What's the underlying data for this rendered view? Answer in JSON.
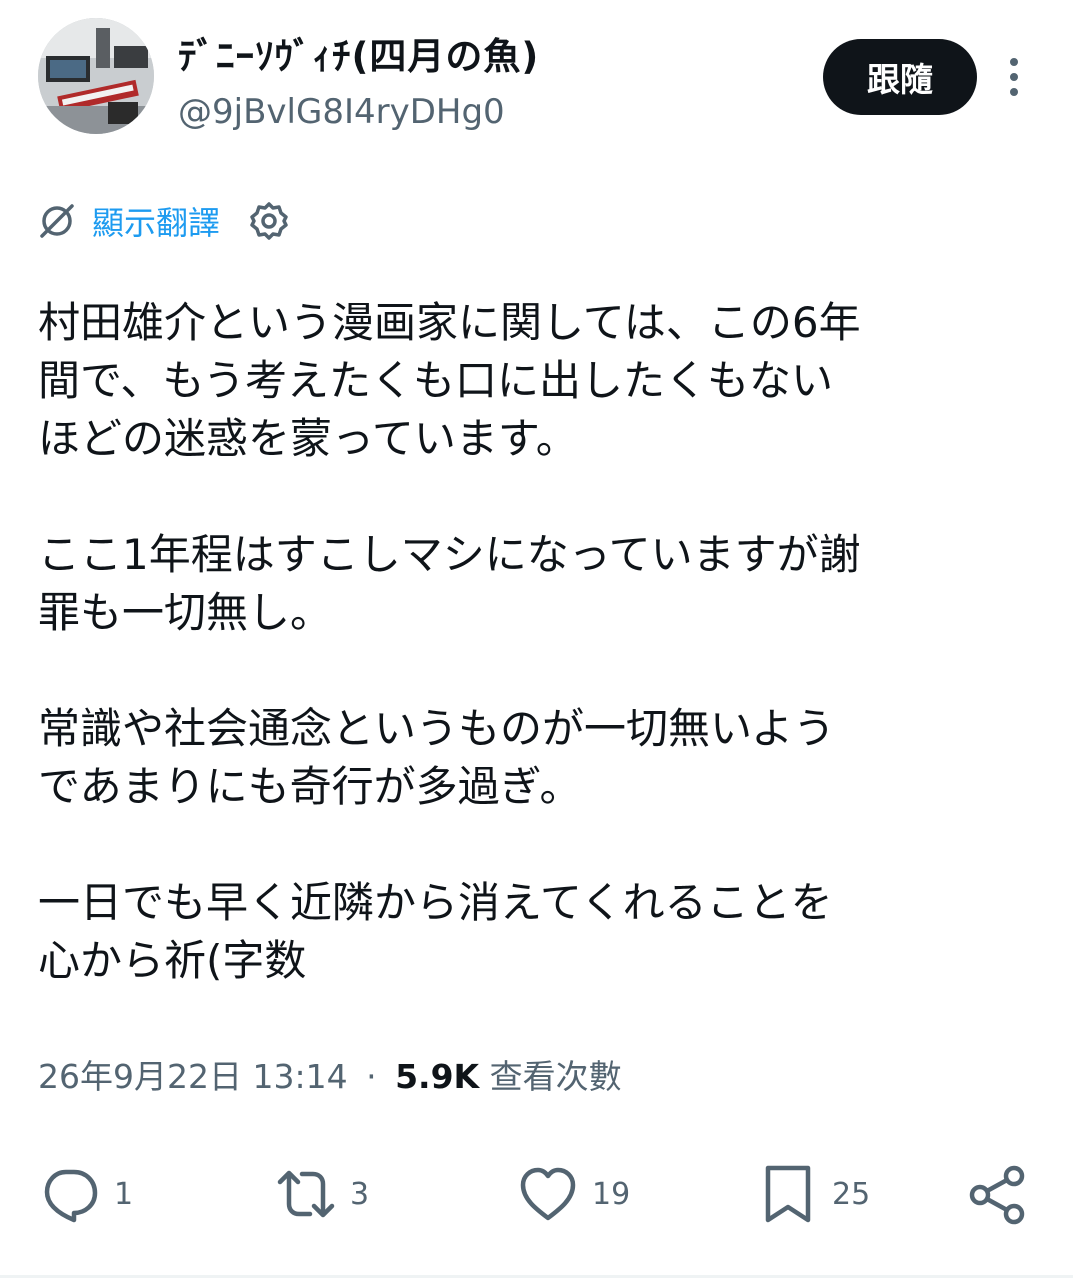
{
  "user": {
    "display_name": "ﾃﾞﾆｰｿｳﾞｨﾁ(四月の魚)",
    "handle": "@9jBvlG8I4ryDHg0",
    "follow_label": "跟隨"
  },
  "translate": {
    "label": "顯示翻譯"
  },
  "tweet": {
    "paragraphs": [
      "村田雄介という漫画家に関しては、この6年\n間で、もう考えたくも口に出したくもない\nほどの迷惑を蒙っています。",
      "ここ1年程はすこしマシになっていますが謝\n罪も一切無し。",
      "常識や社会通念というものが一切無いよう\nであまりにも奇行が多過ぎ。",
      "一日でも早く近隣から消えてくれることを\n心から祈(字数"
    ],
    "timestamp": "26年9月22日 13:14",
    "separator": "·",
    "views_count": "5.9K",
    "views_label": "查看次數"
  },
  "actions": {
    "replies": "1",
    "retweets": "3",
    "likes": "19",
    "bookmarks": "25"
  },
  "colors": {
    "accent": "#1d9bf0",
    "text": "#0f1419",
    "secondary": "#536471"
  }
}
